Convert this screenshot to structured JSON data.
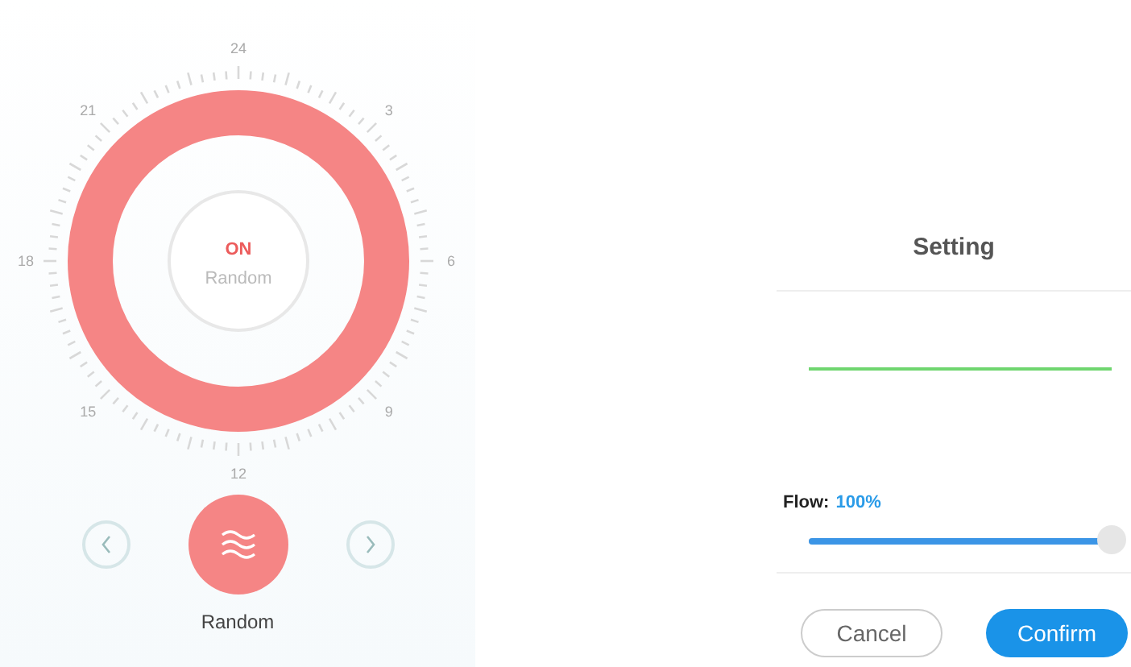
{
  "dial": {
    "hour_labels": [
      "24",
      "3",
      "6",
      "9",
      "12",
      "15",
      "18",
      "21"
    ],
    "status": "ON",
    "mode": "Random"
  },
  "mode_selector": {
    "label": "Random"
  },
  "setting": {
    "title": "Setting",
    "flow": {
      "label": "Flow:",
      "reading": "100%",
      "level": 1
    },
    "buttons": [
      {
        "label": "Cancel",
        "kind": "secondary"
      },
      {
        "label": "Confirm",
        "kind": "primary"
      }
    ]
  }
}
